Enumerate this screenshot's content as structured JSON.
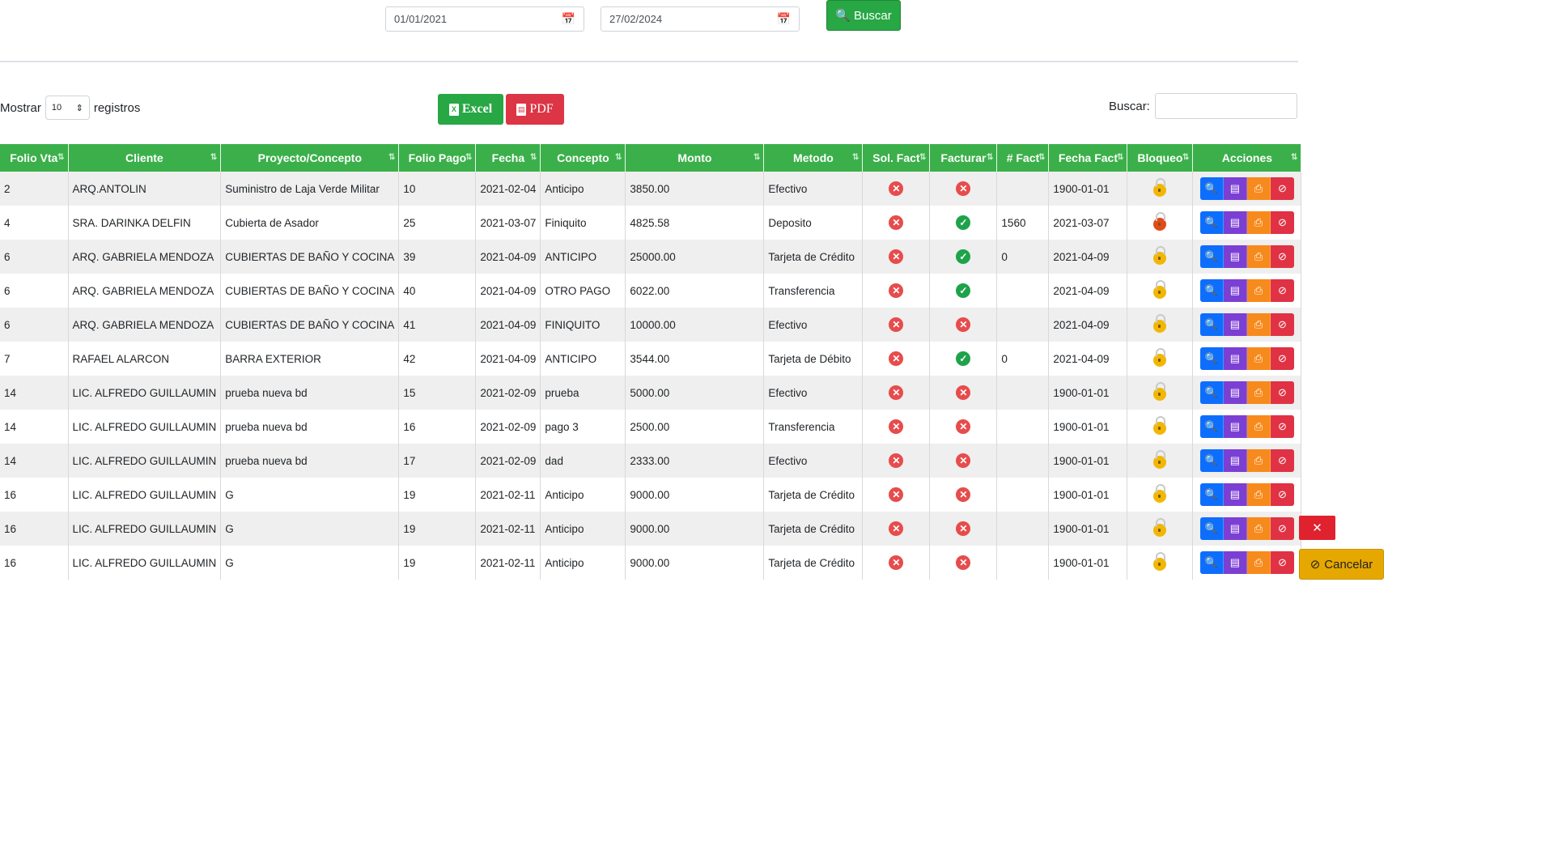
{
  "filters": {
    "date_from": "01/01/2021",
    "date_to": "27/02/2024",
    "search_button": "Buscar"
  },
  "controls": {
    "show_label": "Mostrar",
    "page_size": "10",
    "records_label": "registros",
    "excel_label": "Excel",
    "pdf_label": "PDF",
    "search_label": "Buscar:"
  },
  "table": {
    "headers": [
      "Folio Vta",
      "Cliente",
      "Proyecto/Concepto",
      "Folio Pago",
      "Fecha",
      "Concepto",
      "Monto",
      "Metodo",
      "Sol. Fact",
      "Facturar",
      "# Fact",
      "Fecha Fact",
      "Bloqueo",
      "Acciones"
    ],
    "rows": [
      {
        "folio_vta": "2",
        "cliente": "ARQ.ANTOLIN",
        "proyecto": "Suministro de Laja Verde Militar",
        "folio_pago": "10",
        "fecha": "2021-02-04",
        "concepto": "Anticipo",
        "monto": "3850.00",
        "metodo": "Efectivo",
        "sol_fact": "no",
        "facturar": "no",
        "num_fact": "",
        "fecha_fact": "1900-01-01",
        "bloqueo": "yellow"
      },
      {
        "folio_vta": "4",
        "cliente": "SRA. DARINKA DELFIN",
        "proyecto": "Cubierta de Asador",
        "folio_pago": "25",
        "fecha": "2021-03-07",
        "concepto": "Finiquito",
        "monto": "4825.58",
        "metodo": "Deposito",
        "sol_fact": "no",
        "facturar": "yes",
        "num_fact": "1560",
        "fecha_fact": "2021-03-07",
        "bloqueo": "red"
      },
      {
        "folio_vta": "6",
        "cliente": "ARQ. GABRIELA MENDOZA",
        "proyecto": "CUBIERTAS DE BAÑO Y COCINA",
        "folio_pago": "39",
        "fecha": "2021-04-09",
        "concepto": "ANTICIPO",
        "monto": "25000.00",
        "metodo": "Tarjeta de Crédito",
        "sol_fact": "no",
        "facturar": "yes",
        "num_fact": "0",
        "fecha_fact": "2021-04-09",
        "bloqueo": "yellow"
      },
      {
        "folio_vta": "6",
        "cliente": "ARQ. GABRIELA MENDOZA",
        "proyecto": "CUBIERTAS DE BAÑO Y COCINA",
        "folio_pago": "40",
        "fecha": "2021-04-09",
        "concepto": "OTRO PAGO",
        "monto": "6022.00",
        "metodo": "Transferencia",
        "sol_fact": "no",
        "facturar": "yes",
        "num_fact": "",
        "fecha_fact": "2021-04-09",
        "bloqueo": "yellow"
      },
      {
        "folio_vta": "6",
        "cliente": "ARQ. GABRIELA MENDOZA",
        "proyecto": "CUBIERTAS DE BAÑO Y COCINA",
        "folio_pago": "41",
        "fecha": "2021-04-09",
        "concepto": "FINIQUITO",
        "monto": "10000.00",
        "metodo": "Efectivo",
        "sol_fact": "no",
        "facturar": "no",
        "num_fact": "",
        "fecha_fact": "2021-04-09",
        "bloqueo": "yellow"
      },
      {
        "folio_vta": "7",
        "cliente": "RAFAEL ALARCON",
        "proyecto": "BARRA EXTERIOR",
        "folio_pago": "42",
        "fecha": "2021-04-09",
        "concepto": "ANTICIPO",
        "monto": "3544.00",
        "metodo": "Tarjeta de Débito",
        "sol_fact": "no",
        "facturar": "yes",
        "num_fact": "0",
        "fecha_fact": "2021-04-09",
        "bloqueo": "yellow"
      },
      {
        "folio_vta": "14",
        "cliente": "LIC. ALFREDO GUILLAUMIN",
        "proyecto": "prueba nueva bd",
        "folio_pago": "15",
        "fecha": "2021-02-09",
        "concepto": "prueba",
        "monto": "5000.00",
        "metodo": "Efectivo",
        "sol_fact": "no",
        "facturar": "no",
        "num_fact": "",
        "fecha_fact": "1900-01-01",
        "bloqueo": "yellow"
      },
      {
        "folio_vta": "14",
        "cliente": "LIC. ALFREDO GUILLAUMIN",
        "proyecto": "prueba nueva bd",
        "folio_pago": "16",
        "fecha": "2021-02-09",
        "concepto": "pago 3",
        "monto": "2500.00",
        "metodo": "Transferencia",
        "sol_fact": "no",
        "facturar": "no",
        "num_fact": "",
        "fecha_fact": "1900-01-01",
        "bloqueo": "yellow"
      },
      {
        "folio_vta": "14",
        "cliente": "LIC. ALFREDO GUILLAUMIN",
        "proyecto": "prueba nueva bd",
        "folio_pago": "17",
        "fecha": "2021-02-09",
        "concepto": "dad",
        "monto": "2333.00",
        "metodo": "Efectivo",
        "sol_fact": "no",
        "facturar": "no",
        "num_fact": "",
        "fecha_fact": "1900-01-01",
        "bloqueo": "yellow"
      },
      {
        "folio_vta": "16",
        "cliente": "LIC. ALFREDO GUILLAUMIN",
        "proyecto": "G",
        "folio_pago": "19",
        "fecha": "2021-02-11",
        "concepto": "Anticipo",
        "monto": "9000.00",
        "metodo": "Tarjeta de Crédito",
        "sol_fact": "no",
        "facturar": "no",
        "num_fact": "",
        "fecha_fact": "1900-01-01",
        "bloqueo": "yellow"
      },
      {
        "folio_vta": "16",
        "cliente": "LIC. ALFREDO GUILLAUMIN",
        "proyecto": "G",
        "folio_pago": "19",
        "fecha": "2021-02-11",
        "concepto": "Anticipo",
        "monto": "9000.00",
        "metodo": "Tarjeta de Crédito",
        "sol_fact": "no",
        "facturar": "no",
        "num_fact": "",
        "fecha_fact": "1900-01-01",
        "bloqueo": "yellow"
      },
      {
        "folio_vta": "16",
        "cliente": "LIC. ALFREDO GUILLAUMIN",
        "proyecto": "G",
        "folio_pago": "19",
        "fecha": "2021-02-11",
        "concepto": "Anticipo",
        "monto": "9000.00",
        "metodo": "Tarjeta de Crédito",
        "sol_fact": "no",
        "facturar": "no",
        "num_fact": "",
        "fecha_fact": "1900-01-01",
        "bloqueo": "yellow"
      }
    ]
  },
  "popup": {
    "close_symbol": "✕",
    "cancel_label": "Cancelar"
  },
  "colors": {
    "header_green": "#3bb04a",
    "success": "#28a745",
    "danger": "#dc3545",
    "warning": "#e6a800",
    "primary": "#0d6efd",
    "purple": "#7b3fd4",
    "orange": "#f78a1d"
  }
}
